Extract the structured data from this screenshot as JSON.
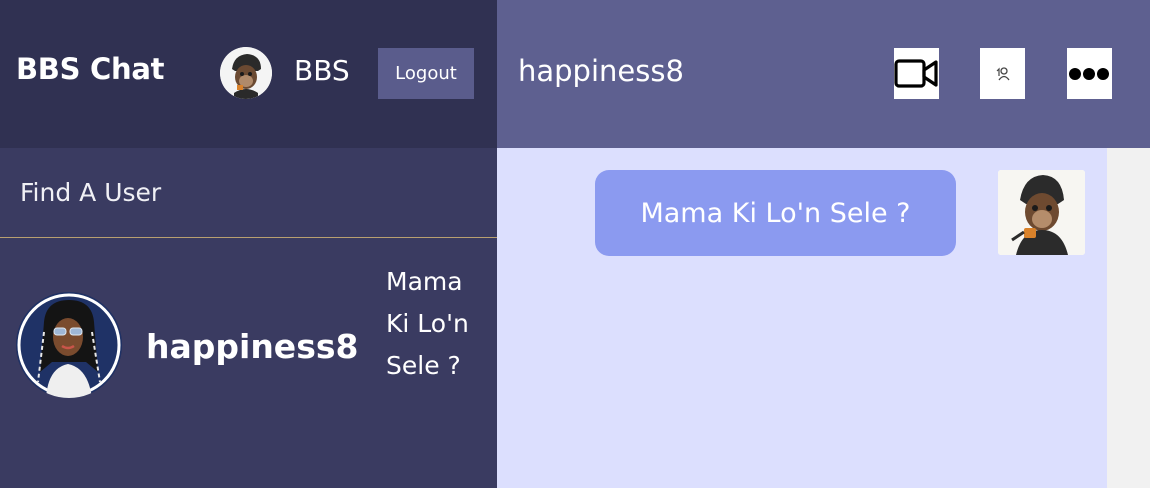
{
  "app": {
    "brand": "BBS Chat"
  },
  "current_user": {
    "name": "BBS",
    "avatar_icon": "monkey-hoodie-avatar-icon"
  },
  "header": {
    "logout_label": "Logout"
  },
  "search": {
    "placeholder": "Find A User"
  },
  "contacts": [
    {
      "name": "happiness8",
      "preview": "Mama Ki Lo'n Sele ?",
      "avatar_icon": "woman-sunglasses-avatar-icon"
    }
  ],
  "chat": {
    "title": "happiness8",
    "actions": [
      {
        "name": "video-call",
        "icon": "video-camera-icon"
      },
      {
        "name": "view-profile",
        "icon": "person-icon"
      },
      {
        "name": "more-options",
        "icon": "ellipsis-icon"
      }
    ],
    "messages": [
      {
        "text": "Mama Ki Lo'n Sele ?",
        "direction": "sent"
      }
    ]
  },
  "colors": {
    "sidebar_bg": "#3a3b61",
    "sidebar_header_bg": "#303152",
    "chat_header_bg": "#5e6090",
    "messages_bg": "#dcdffe",
    "bubble_bg": "#8b9af0",
    "logout_bg": "#5a5c8c",
    "divider": "#b8a070"
  }
}
